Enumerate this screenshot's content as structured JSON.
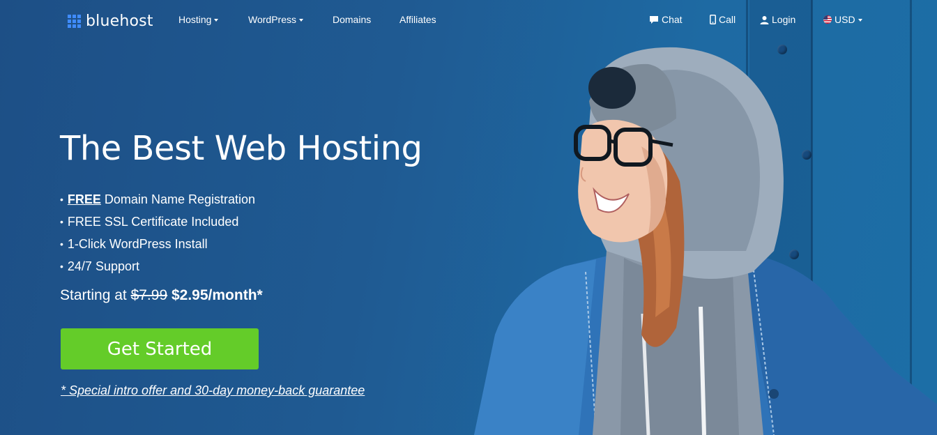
{
  "brand": {
    "name": "bluehost",
    "accent_color": "#3f8cff"
  },
  "nav": {
    "left_items": [
      {
        "label": "Hosting",
        "has_dropdown": true
      },
      {
        "label": "WordPress",
        "has_dropdown": true
      },
      {
        "label": "Domains",
        "has_dropdown": false
      },
      {
        "label": "Affiliates",
        "has_dropdown": false
      }
    ],
    "right_items": [
      {
        "label": "Chat",
        "icon": "chat-bubble-icon"
      },
      {
        "label": "Call",
        "icon": "phone-icon"
      },
      {
        "label": "Login",
        "icon": "user-icon"
      },
      {
        "label": "USD",
        "icon": "us-flag-icon",
        "has_dropdown": true
      }
    ]
  },
  "hero": {
    "headline": "The Best Web Hosting",
    "features": [
      {
        "strong": "FREE",
        "text": "Domain Name Registration"
      },
      {
        "text": "FREE SSL Certificate Included"
      },
      {
        "text": "1-Click WordPress Install"
      },
      {
        "text": "24/7 Support"
      }
    ],
    "pricing": {
      "prefix": "Starting at",
      "old_price": "$7.99",
      "new_price": "$2.95/month*"
    },
    "cta_label": "Get Started",
    "cta_color": "#64cc29",
    "disclaimer": "* Special intro offer and 30-day money-back guarantee"
  }
}
